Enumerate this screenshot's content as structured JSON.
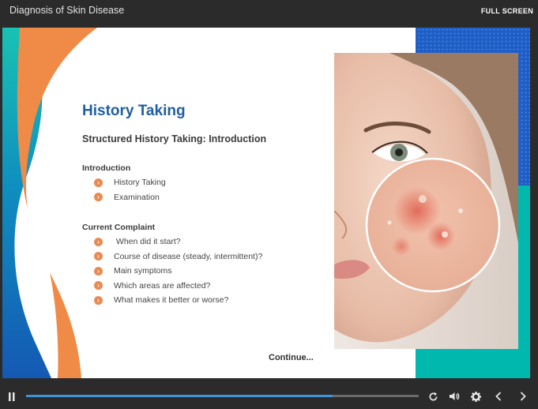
{
  "header": {
    "course_title": "Diagnosis of Skin Disease",
    "fullscreen_label": "FULL SCREEN"
  },
  "slide": {
    "heading": "History Taking",
    "subheading": "Structured History Taking: Introduction",
    "sections": [
      {
        "label": "Introduction",
        "items": [
          "History Taking",
          "Examination"
        ]
      },
      {
        "label": "Current Complaint",
        "items": [
          " When did it start?",
          "Course of disease (steady, intermittent)?",
          "Main symptoms",
          "Which areas are affected?",
          "What makes it better or worse?"
        ]
      }
    ],
    "continue_label": "Continue...",
    "image_alt": "Woman's face with magnified inset of acne on cheek"
  },
  "player": {
    "progress": 0.78,
    "icons": [
      "pause-icon",
      "replay-icon",
      "volume-icon",
      "settings-icon",
      "chevron-left-icon",
      "chevron-right-icon"
    ]
  },
  "colors": {
    "heading": "#1f5fa0",
    "accent_orange": "#f08a47",
    "accent_teal": "#00b8ad",
    "accent_blue": "#1565c0",
    "progress": "#3e95d6"
  }
}
